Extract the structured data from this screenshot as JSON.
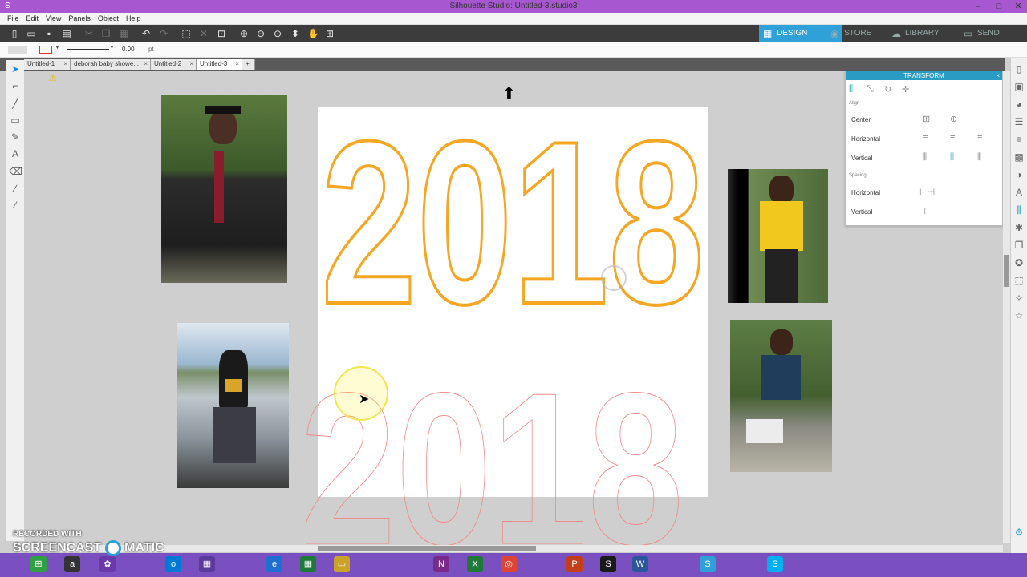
{
  "window": {
    "title": "Silhouette Studio: Untitled-3.studio3",
    "minimize": "–",
    "maximize": "□",
    "close": "✕"
  },
  "menu": [
    "File",
    "Edit",
    "View",
    "Panels",
    "Object",
    "Help"
  ],
  "nav_tabs": [
    {
      "label": "DESIGN",
      "icon": "grid-icon"
    },
    {
      "label": "STORE",
      "icon": "store-icon"
    },
    {
      "label": "LIBRARY",
      "icon": "cloud-icon"
    },
    {
      "label": "SEND",
      "icon": "cutter-icon"
    }
  ],
  "options": {
    "line_width": "0.00",
    "unit": "pt"
  },
  "doc_tabs": [
    "Untitled-1",
    "deborah baby showe...",
    "Untitled-2",
    "Untitled-3"
  ],
  "active_doc_tab": "Untitled-3",
  "canvas": {
    "main_text": "2018",
    "ghost_text": "2018"
  },
  "transform_panel": {
    "title": "TRANSFORM",
    "align_section": "Align",
    "center_label": "Center",
    "horizontal_label": "Horizontal",
    "vertical_label": "Vertical",
    "spacing_section": "Spacing",
    "spacing_horizontal_label": "Horizontal",
    "spacing_vertical_label": "Vertical"
  },
  "watermark": {
    "line1": "RECORDED WITH",
    "line2a": "SCREENCAST",
    "line2b": "MATIC"
  },
  "colors": {
    "accent": "#2fa0d8",
    "outline_orange": "#f5a623",
    "titlebar": "#a757d0",
    "taskbar": "#7a4fc0"
  }
}
